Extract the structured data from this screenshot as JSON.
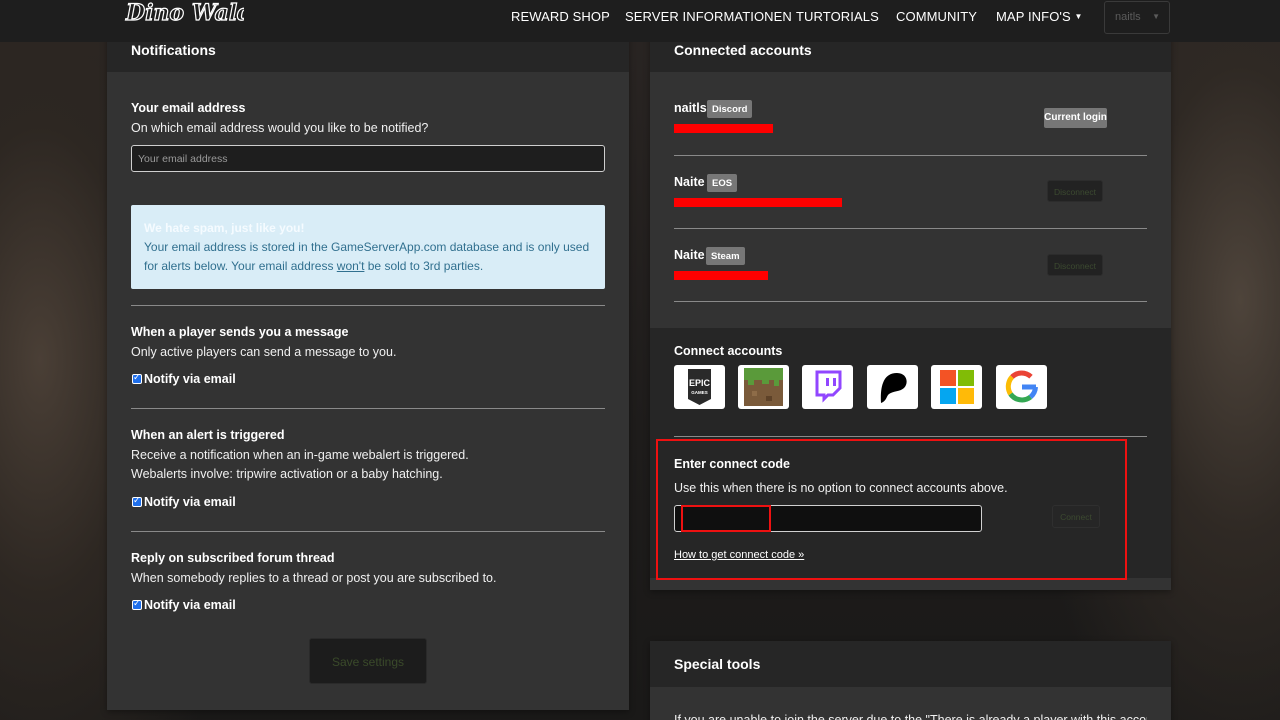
{
  "nav": {
    "logo_text": "Dino Wald",
    "items": [
      "REWARD SHOP",
      "SERVER INFORMATIONEN",
      "TURTORIALS",
      "COMMUNITY",
      "MAP INFO'S"
    ],
    "user": "naitls"
  },
  "notifications": {
    "title": "Notifications",
    "email_label": "Your email address",
    "email_help": "On which email address would you like to be notified?",
    "email_placeholder": "Your email address",
    "alert": {
      "title": "We hate spam, just like you!",
      "line1": "Your email address is stored in the GameServerApp.com database and is only used",
      "line2_pre": "for alerts below. Your email address ",
      "line2_u": "won't",
      "line2_post": " be sold to 3rd parties."
    },
    "sections": [
      {
        "title": "When a player sends you a message",
        "lines": [
          "Only active players can send a message to you."
        ],
        "checkbox": "Notify via email"
      },
      {
        "title": "When an alert is triggered",
        "lines": [
          "Receive a notification when an in-game webalert is triggered.",
          "Webalerts involve: tripwire activation or a baby hatching."
        ],
        "checkbox": "Notify via email"
      },
      {
        "title": "Reply on subscribed forum thread",
        "lines": [
          "When somebody replies to a thread or post you are subscribed to."
        ],
        "checkbox": "Notify via email"
      }
    ],
    "save_label": "Save settings"
  },
  "connected": {
    "title": "Connected accounts",
    "accounts": [
      {
        "name": "naitls",
        "badge": "Discord",
        "action": "Current login"
      },
      {
        "name": "Naite",
        "badge": "EOS",
        "action": "Disconnect"
      },
      {
        "name": "Naite",
        "badge": "Steam",
        "action": "Disconnect"
      }
    ],
    "connect_title": "Connect accounts",
    "providers": [
      "epic-games-icon",
      "minecraft-icon",
      "twitch-icon",
      "patreon-icon",
      "microsoft-icon",
      "google-icon"
    ],
    "epic_line1": "EPIC",
    "epic_line2": "GAMES",
    "code_title": "Enter connect code",
    "code_help": "Use this when there is no option to connect accounts above.",
    "connect_label": "Connect",
    "howto": "How to get connect code »"
  },
  "special": {
    "title": "Special tools",
    "partial_text": "If you are unable to join the server due to the \"There is already a player with this account"
  }
}
